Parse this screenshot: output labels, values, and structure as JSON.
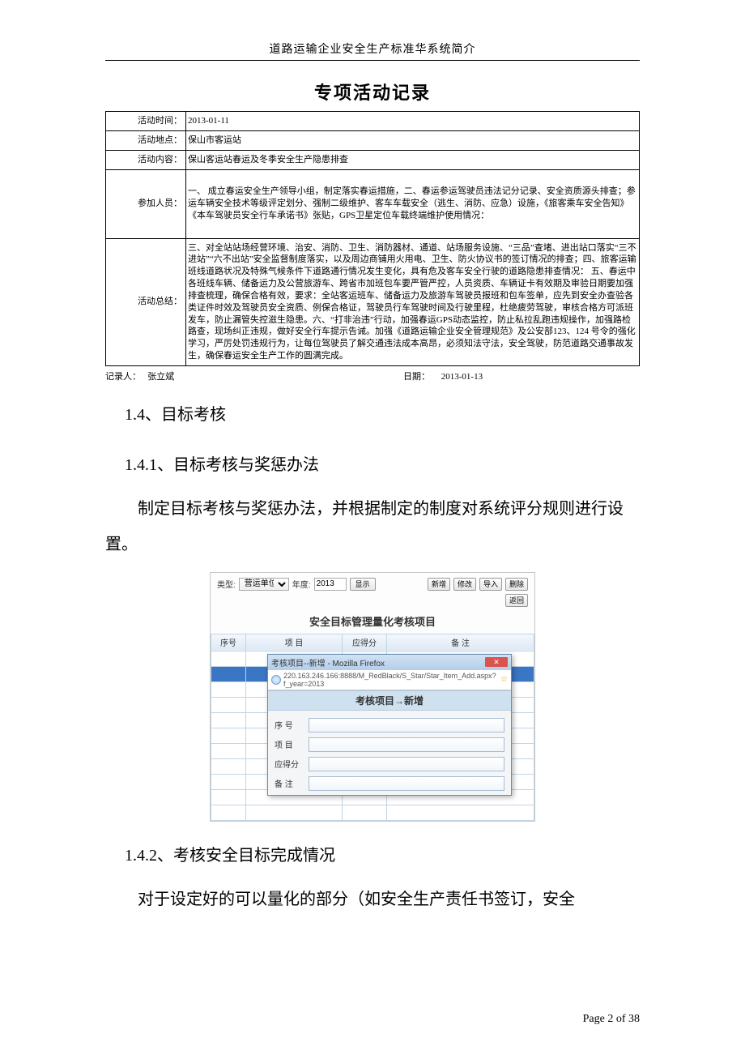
{
  "running_head": "道路运输企业安全生产标准华系统简介",
  "record": {
    "title": "专项活动记录",
    "rows": {
      "time_label": "活动时间：",
      "time_value": "2013-01-11",
      "place_label": "活动地点：",
      "place_value": "保山市客运站",
      "content_label": "活动内容：",
      "content_value": "保山客运站春运及冬季安全生产隐患排查",
      "people_label": "参加人员：",
      "people_value": "一、 成立春运安全生产领导小组，制定落实春运措施，二、春运参运驾驶员违法记分记录、安全资质源头排查；参运车辆安全技术等级评定划分、强制二级维护、客车车载安全（逃生、消防、应急）设施，《旅客乘车安全告知》《本车驾驶员安全行车承诺书》张贴，GPS卫星定位车载终端维护使用情况：",
      "summary_label": "活动总结：",
      "summary_value": "三、对全站站场经营环境、治安、消防、卫生、消防器材、通道、站场服务设施、“三品”查堵、进出站口落实“三不进站”“六不出站”安全监督制度落实，以及周边商铺用火用电、卫生、防火协议书的签订情况的排查；四、旅客运输班线道路状况及特殊气候条件下道路通行情况发生变化，具有危及客车安全行驶的道路隐患排查情况：  五、春运中各班线车辆、储备运力及公营旅游车、跨省市加班包车要严管严控，人员资质、车辆证卡有效期及审验日期要加强排查梳理，确保合格有效，要求：全站客运班车、储备运力及旅游车驾驶员报班和包车签单，应先到安全办查验各类证件时效及驾驶员安全资质、例保合格证，驾驶员行车驾驶时间及行驶里程，杜绝疲劳驾驶，审核合格方可派班发车，防止漏管失控滋生隐患。六、“打非治违”行动，加强春运GPS动态监控，防止私拉乱跑违规操作，加强路检路查，现场纠正违规，做好安全行车提示告诫。加强《道路运输企业安全管理规范》及公安部123、124 号令的强化学习，严厉处罚违规行为，让每位驾驶员了解交通违法成本高昂，必须知法守法，安全驾驶，防范道路交通事故发生，确保春运安全生产工作的圆满完成。"
    },
    "footer": {
      "recorder_label": "记录人：",
      "recorder_value": "张立斌",
      "date_label": "日期：",
      "date_value": "2013-01-13"
    }
  },
  "sections": {
    "s14": "1.4、目标考核",
    "s141": "1.4.1、目标考核与奖惩办法",
    "p141": "制定目标考核与奖惩办法，并根据制定的制度对系统评分规则进行设置。",
    "s142": "1.4.2、考核安全目标完成情况",
    "p142": "对于设定好的可以量化的部分（如安全生产责任书签订，安全"
  },
  "ui": {
    "type_label": "类型:",
    "type_value": "营运单位",
    "year_label": "年度:",
    "year_value": "2013",
    "btn_show": "显示",
    "btn_new": "新增",
    "btn_edit": "修改",
    "btn_import": "导入",
    "btn_delete": "删除",
    "btn_back": "返回",
    "panel_title": "安全目标管理量化考核项目",
    "col_no": "序号",
    "col_item": "项    目",
    "col_score": "应得分",
    "col_remark": "备    注",
    "dialog": {
      "window_title": "考核项目--新增 - Mozilla Firefox",
      "url": "220.163.246.166:8888/M_RedBlack/S_Star/Star_Item_Add.aspx?f_year=2013",
      "body_title": "考核项目→新增",
      "f_no": "序 号",
      "f_item": "项 目",
      "f_score": "应得分",
      "f_remark": "备 注"
    }
  },
  "page_number": "Page 2 of 38"
}
